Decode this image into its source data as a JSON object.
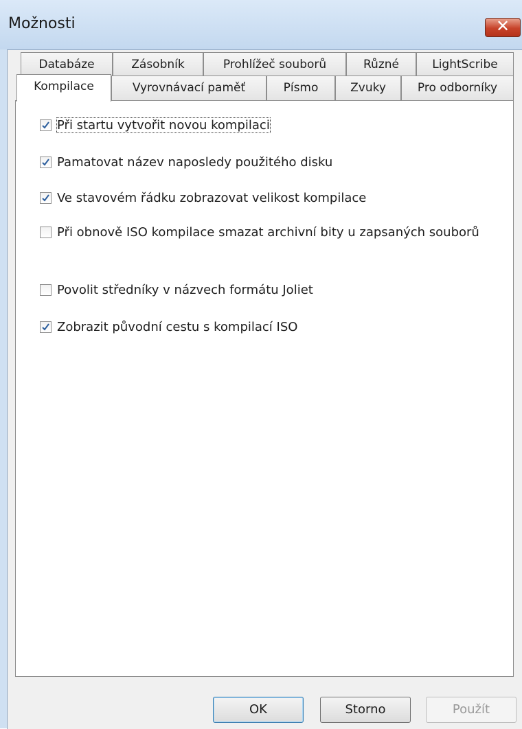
{
  "window": {
    "title": "Možnosti",
    "close_glyph": "✕"
  },
  "tabs_top": [
    "Databáze",
    "Zásobník",
    "Prohlížeč souborů",
    "Různé",
    "LightScribe"
  ],
  "tabs_bottom": [
    "Kompilace",
    "Vyrovnávací paměť",
    "Písmo",
    "Zvuky",
    "Pro odborníky"
  ],
  "active_tab": "Kompilace",
  "options": [
    {
      "label": "Při startu vytvořit novou kompilaci",
      "checked": true
    },
    {
      "label": "Pamatovat název naposledy použitého disku",
      "checked": true
    },
    {
      "label": "Ve stavovém řádku zobrazovat velikost kompilace",
      "checked": true
    },
    {
      "label": "Při obnově ISO kompilace smazat archivní bity u zapsaných souborů",
      "checked": false
    },
    {
      "label": "Povolit středníky v názvech formátu Joliet",
      "checked": false
    },
    {
      "label": "Zobrazit původní cestu s kompilací ISO",
      "checked": true
    }
  ],
  "buttons": {
    "ok": "OK",
    "cancel": "Storno",
    "apply": "Použít"
  },
  "colors": {
    "check": "#2a5d9c",
    "close": "#c7432a"
  }
}
